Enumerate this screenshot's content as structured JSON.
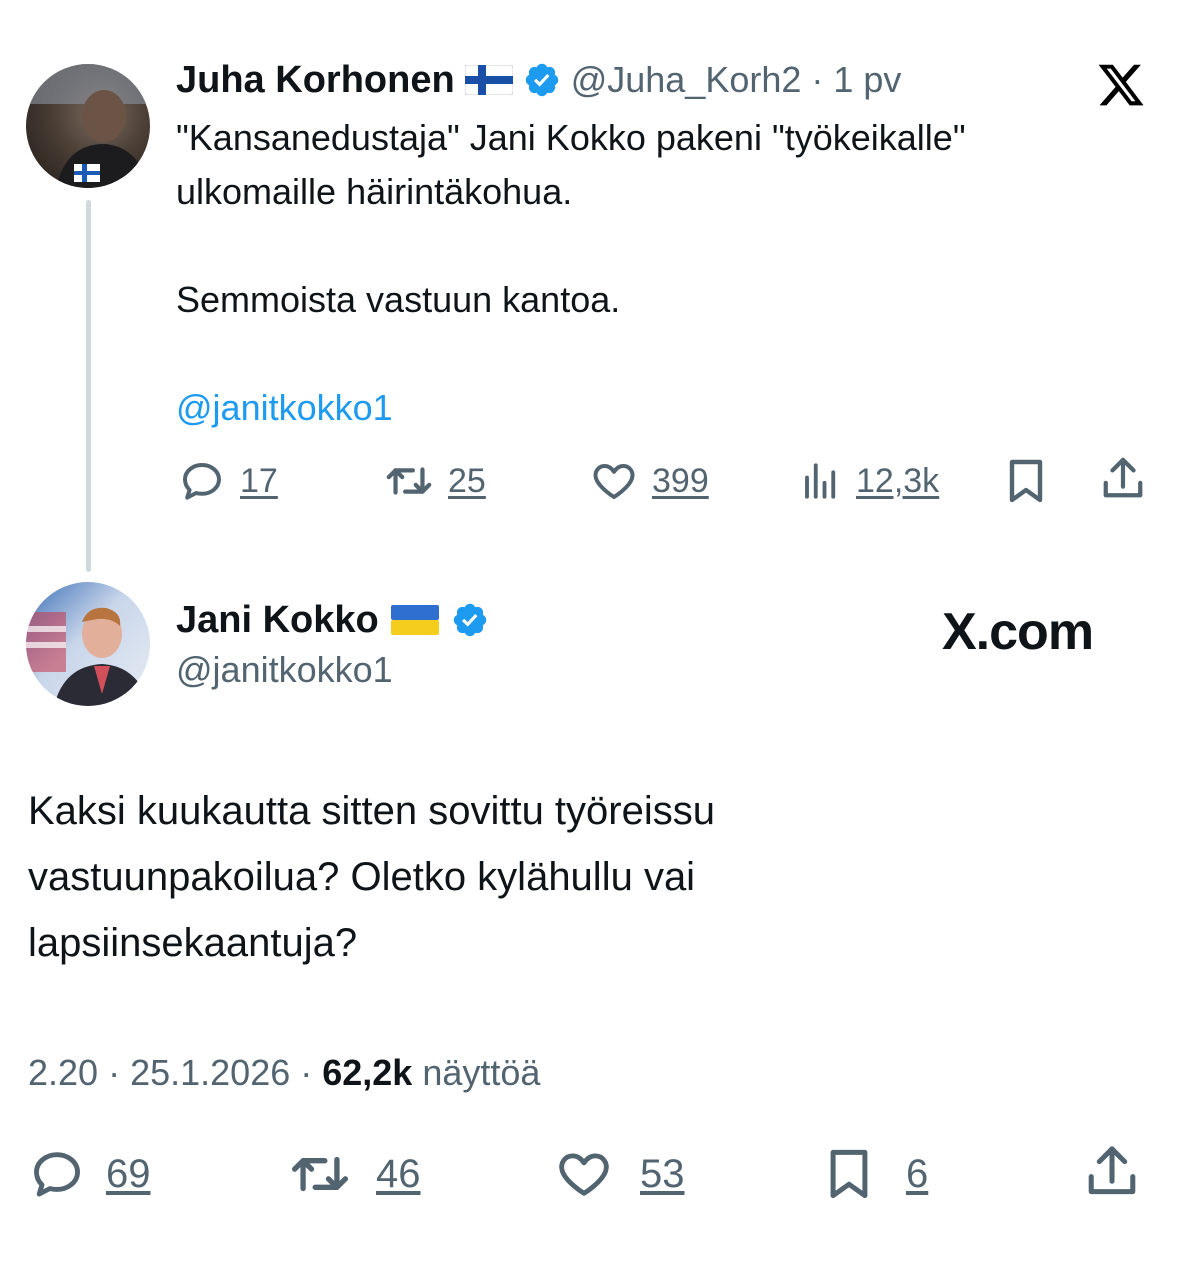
{
  "logo": {
    "icon": "x-logo-icon",
    "domain": "X.com"
  },
  "quoted_tweet": {
    "author_name": "Juha Korhonen",
    "author_flag": "finland-flag-icon",
    "verified": true,
    "handle": "@Juha_Korh2",
    "separator": "·",
    "time_ago": "1 pv",
    "lines": [
      "\"Kansanedustaja\" Jani Kokko pakeni \"työkeikalle\"",
      "ulkomaille häirintäkohua.",
      "Semmoista vastuun kantoa."
    ],
    "mention": "@janitkokko1",
    "stats": {
      "replies": "17",
      "retweets": "25",
      "likes": "399",
      "views": "12,3k"
    }
  },
  "reply_tweet": {
    "author_name": "Jani Kokko",
    "author_flag": "ukraine-flag-icon",
    "verified": true,
    "handle": "@janitkokko1",
    "lines": [
      "Kaksi kuukautta sitten sovittu työreissu",
      "vastuunpakoilua? Oletko kylähullu vai",
      "lapsiinsekaantuja?"
    ],
    "meta": {
      "time": "2.20",
      "sep1": "·",
      "date": "25.1.2026",
      "sep2": "·",
      "views_count": "62,2k",
      "views_label": "näyttöä"
    },
    "stats": {
      "replies": "69",
      "retweets": "46",
      "likes": "53",
      "bookmarks": "6"
    }
  },
  "colors": {
    "text": "#0f1419",
    "secondary": "#536471",
    "link": "#1d9bf0",
    "verified": "#1d9bf0",
    "thread_line": "#cfd9de"
  }
}
